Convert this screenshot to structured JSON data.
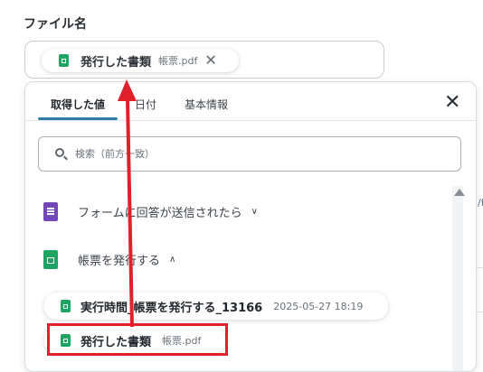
{
  "field": {
    "label": "ファイル名",
    "chip": {
      "name": "発行した書類",
      "sub": "帳票.pdf",
      "close": "✕",
      "icon": "sheets-icon"
    }
  },
  "dropdown": {
    "tabs": [
      {
        "label": "取得した値",
        "active": true
      },
      {
        "label": "日付",
        "active": false
      },
      {
        "label": "基本情報",
        "active": false
      }
    ],
    "close": "✕",
    "search": {
      "placeholder": "検索（前方一致）",
      "value": ""
    },
    "sections": [
      {
        "label": "フォームに回答が送信されたら",
        "icon": "google-forms-icon",
        "chevron": "∨",
        "expanded": false
      },
      {
        "label": "帳票を発行する",
        "icon": "google-sheets-icon",
        "chevron": "∧",
        "expanded": true
      }
    ],
    "items": [
      {
        "name": "実行時間_帳票を発行する_13166",
        "sub": "2025-05-27 18:19"
      },
      {
        "name": "発行した書類",
        "sub": "帳票.pdf"
      }
    ],
    "edge_text": "/f"
  },
  "annotation": {
    "color": "#e0202a"
  }
}
